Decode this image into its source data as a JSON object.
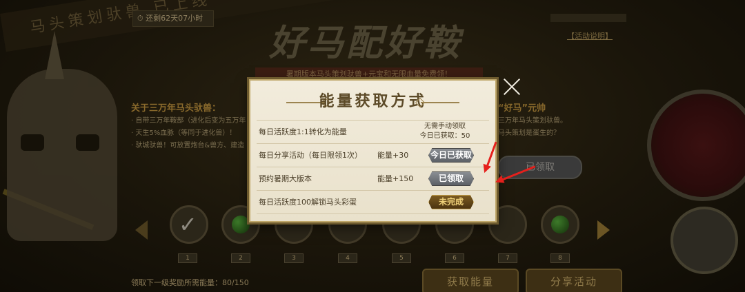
{
  "background": {
    "timer": "还剩62天07小时",
    "event_title": "好马配好鞍",
    "event_subtitle": "暑期版本马头策划驮兽+元宝和无限血量免费领！",
    "rules_link": "【活动说明】",
    "diagonal_banner": "马头策划驮兽 已上线",
    "left_panel": {
      "heading": "关于三万年马头驮兽：",
      "lines": [
        "· 自带三万年鞍部（进化后变为五万年",
        "· 天生5%血脉（等同于进化兽）！",
        "· 驮城驮兽！可放置炮台&兽方、建造"
      ]
    },
    "right_panel": {
      "heading": "“好马”元帅",
      "lines": [
        "三万年马头策划驮兽。",
        "马头策划是蛋生的？"
      ],
      "claim_button": "已领取"
    },
    "milestones": [
      "1",
      "2",
      "3",
      "4",
      "5",
      "6",
      "7",
      "8"
    ],
    "bottom_requirement": "领取下一级奖励所需能量：80/150",
    "bottom_buttons": [
      "获取能量",
      "分享活动"
    ]
  },
  "modal": {
    "title": "能量获取方式",
    "rows": [
      {
        "label": "每日活跃度1:1转化为能量",
        "reward": "",
        "auto_line1": "无需手动领取",
        "auto_line2": "今日已获取：50",
        "button": ""
      },
      {
        "label": "每日分享活动（每日限领1次）",
        "reward": "能量+30",
        "button": "今日已获取",
        "state": "grey"
      },
      {
        "label": "预约暑期大版本",
        "reward": "能量+150",
        "button": "已领取",
        "state": "grey"
      },
      {
        "label": "每日活跃度100解锁马头彩蛋",
        "reward": "",
        "button": "未完成",
        "state": "gold"
      }
    ]
  },
  "icons": {
    "close": "close-icon",
    "arrow_left": "arrow-left-icon",
    "arrow_right": "arrow-right-icon",
    "annotation": "red-arrow-icon"
  },
  "colors": {
    "modal_bg": "#ece5d2",
    "accent_gold": "#c8a24a",
    "annotation_red": "#e5201c"
  }
}
